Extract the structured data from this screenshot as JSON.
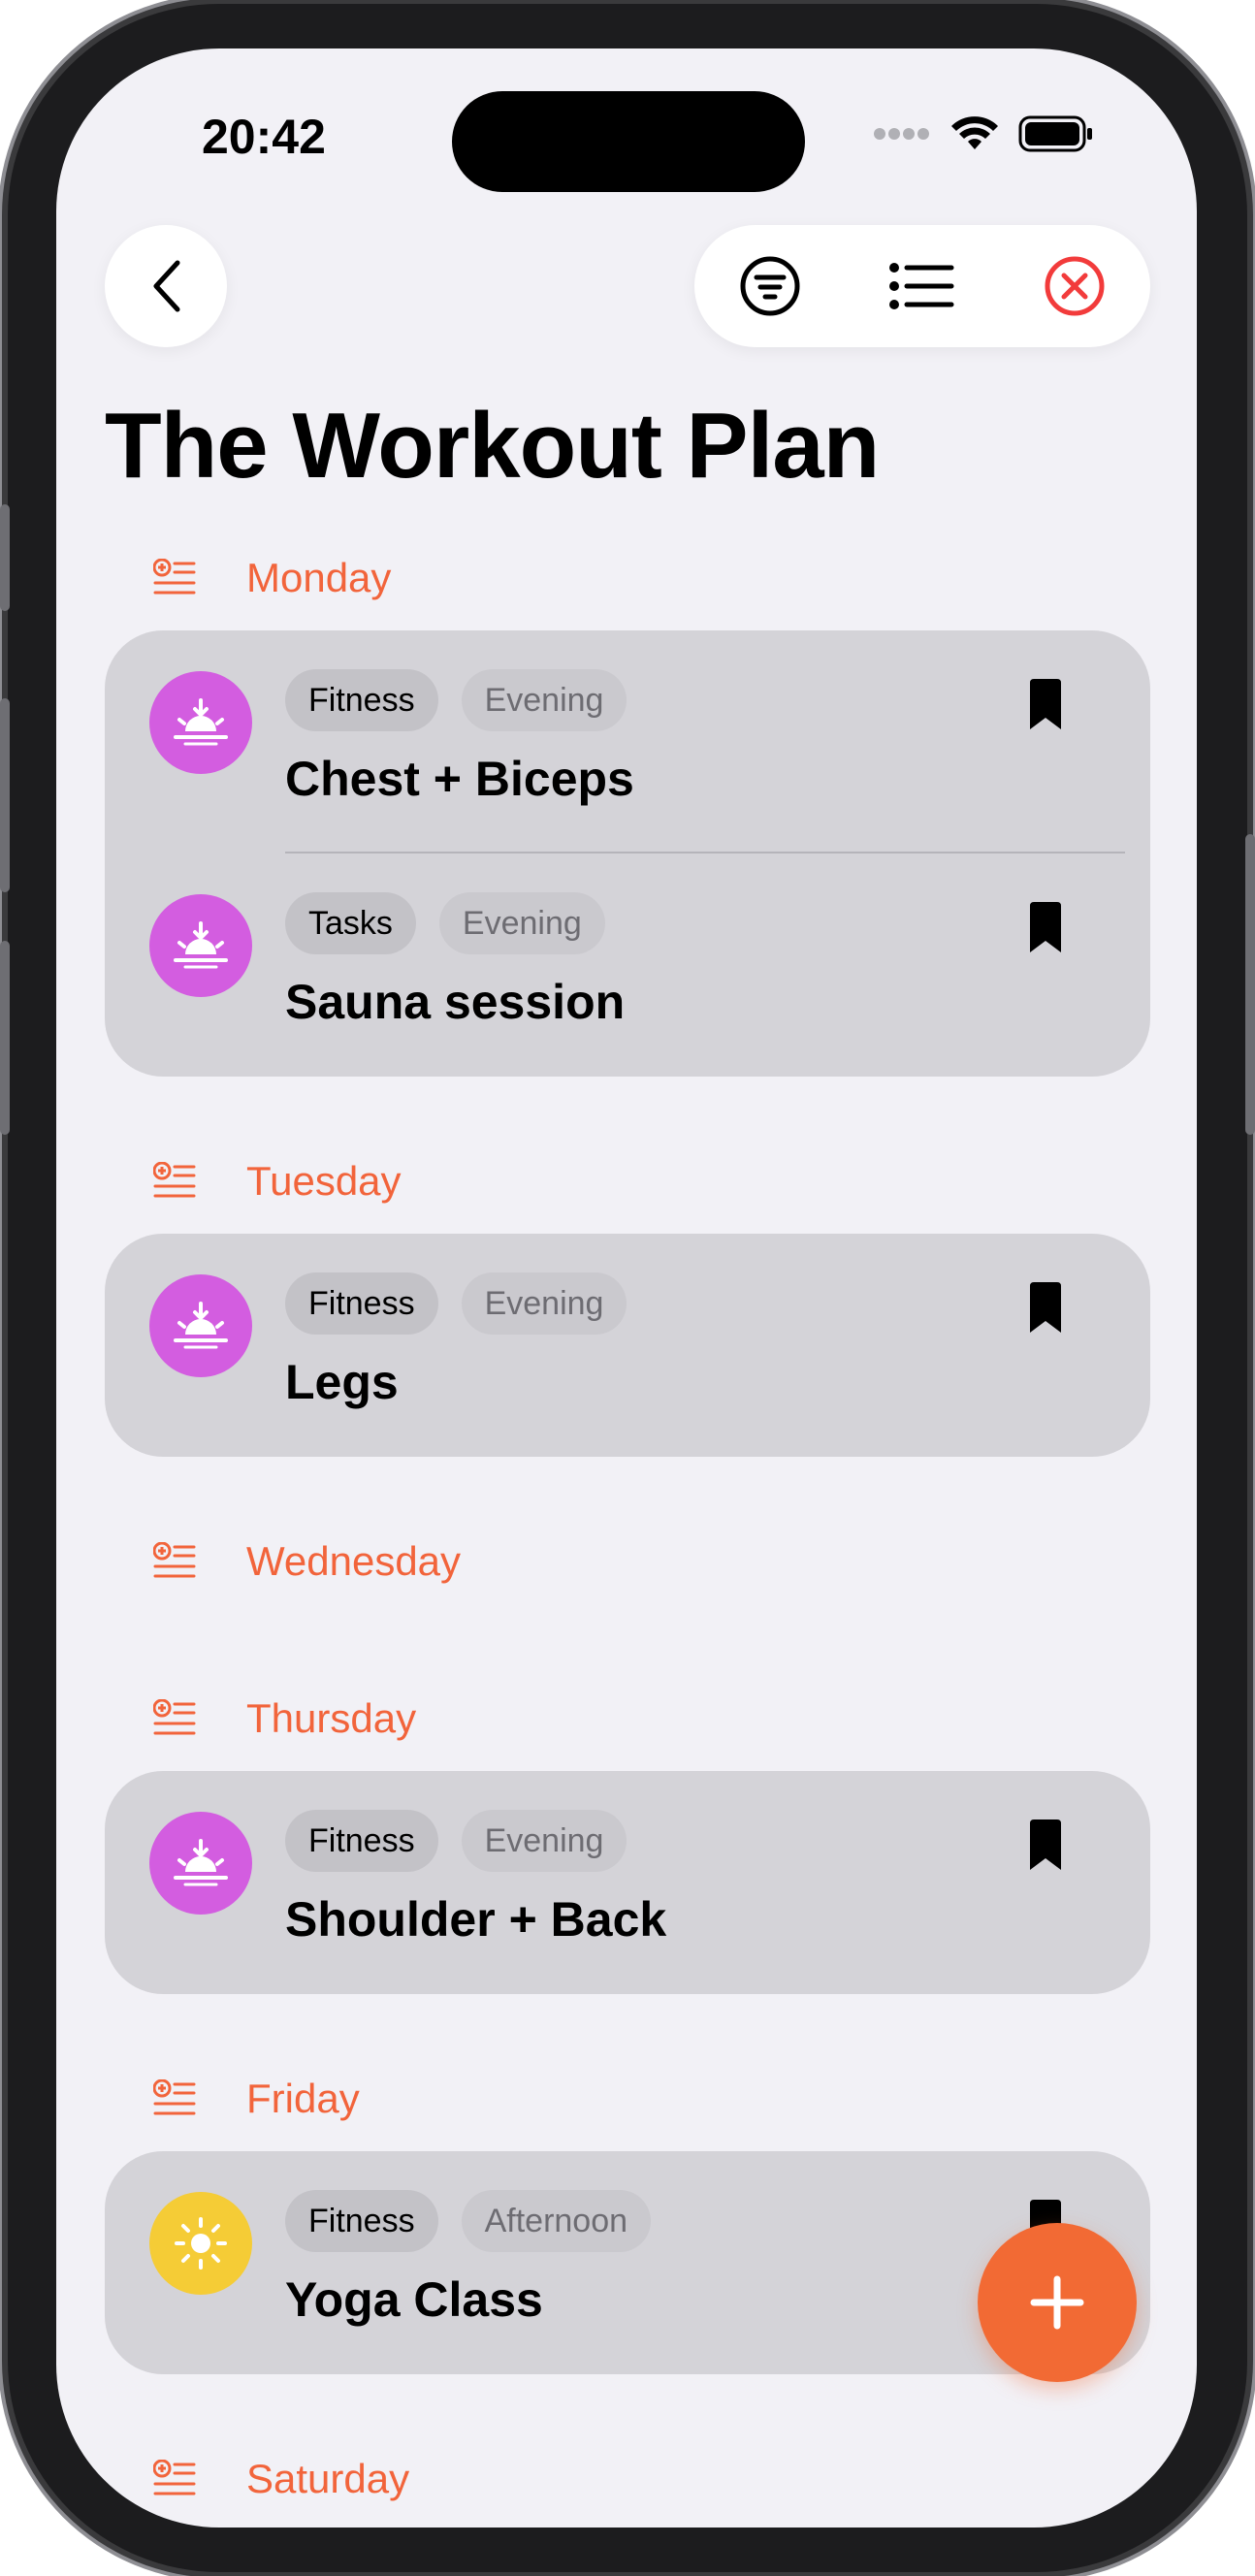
{
  "status_bar": {
    "time": "20:42"
  },
  "header": {
    "back_icon": "chevron-left-icon",
    "toolbar_icons": [
      "filter-icon",
      "list-icon",
      "close-circle-icon"
    ]
  },
  "page": {
    "title": "The Workout Plan"
  },
  "colors": {
    "accent": "#f2643b",
    "evening_icon": "#d35de0",
    "afternoon_icon": "#f5cc36",
    "card_bg": "#d4d3d8",
    "screen_bg": "#f2f1f6"
  },
  "days": [
    {
      "name": "Monday",
      "items": [
        {
          "category": "Fitness",
          "time": "Evening",
          "title": "Chest + Biceps",
          "icon": "sunset-icon"
        },
        {
          "category": "Tasks",
          "time": "Evening",
          "title": "Sauna session",
          "icon": "sunset-icon"
        }
      ]
    },
    {
      "name": "Tuesday",
      "items": [
        {
          "category": "Fitness",
          "time": "Evening",
          "title": "Legs",
          "icon": "sunset-icon"
        }
      ]
    },
    {
      "name": "Wednesday",
      "items": []
    },
    {
      "name": "Thursday",
      "items": [
        {
          "category": "Fitness",
          "time": "Evening",
          "title": "Shoulder + Back",
          "icon": "sunset-icon"
        }
      ]
    },
    {
      "name": "Friday",
      "items": [
        {
          "category": "Fitness",
          "time": "Afternoon",
          "title": "Yoga Class",
          "icon": "sun-icon"
        }
      ]
    },
    {
      "name": "Saturday",
      "items": []
    }
  ],
  "fab": {
    "icon": "plus-icon"
  }
}
